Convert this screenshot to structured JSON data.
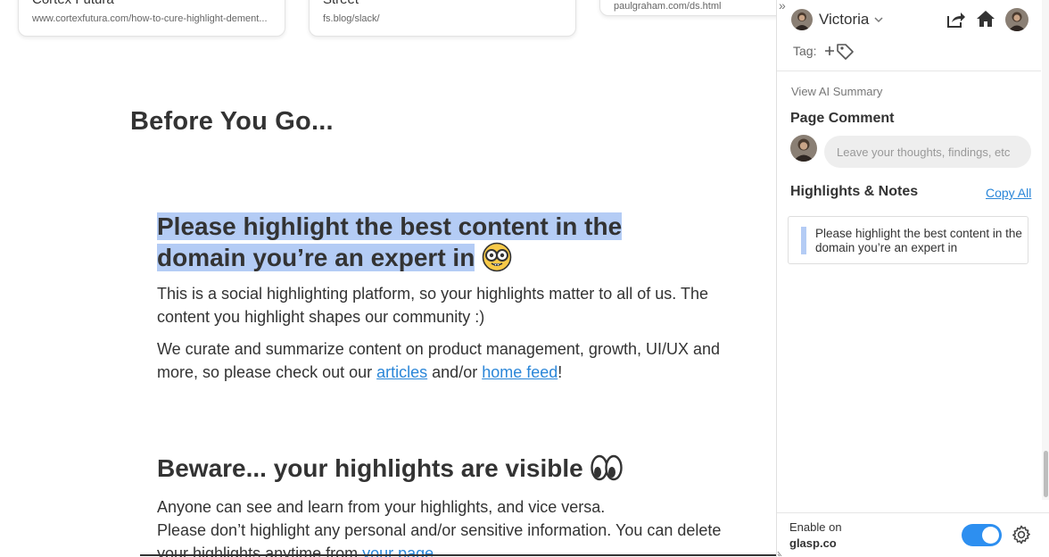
{
  "page": {
    "cards": [
      {
        "title": "Cortex Futura",
        "url": "www.cortexfutura.com/how-to-cure-highlight-dement..."
      },
      {
        "title": "Street",
        "url": "fs.blog/slack/"
      },
      {
        "url": "paulgraham.com/ds.html"
      }
    ],
    "before_go": "Before You Go...",
    "highlight_heading": {
      "line1": "Please highlight the best content in the",
      "line2": "domain you’re an expert in",
      "emoji": "nerd-face-icon"
    },
    "para1": "This is a social highlighting platform, so your highlights matter to all of us. The content you highlight shapes our community :)",
    "para2": {
      "before": "We curate and summarize content on product management, growth, UI/UX and more, so please check out our ",
      "link1": "articles",
      "middle": " and/or ",
      "link2": "home feed",
      "after": "!"
    },
    "beware_heading": "Beware... your highlights are visible",
    "para3": {
      "line1": "Anyone can see and learn from your highlights, and vice versa.",
      "line2": "Please don’t highlight any personal and/or sensitive information. You can delete",
      "line3_before": "your highlights anytime from ",
      "line3_link": "your page"
    }
  },
  "sidebar": {
    "user": {
      "name": "Victoria"
    },
    "tag_label": "Tag:",
    "view_ai_summary": "View AI Summary",
    "page_comment_title": "Page Comment",
    "comment_placeholder": "Leave your thoughts, findings, etc",
    "highlights_title": "Highlights & Notes",
    "copy_all": "Copy All",
    "highlights": [
      {
        "text": "Please highlight the best content in the domain you’re an expert in"
      }
    ],
    "footer": {
      "enable_label": "Enable on",
      "domain": "glasp.co",
      "toggle_on": true
    },
    "colors": {
      "accent": "#2d8ff0",
      "highlight": "#b4ccf5",
      "link": "#2a86d8"
    }
  }
}
